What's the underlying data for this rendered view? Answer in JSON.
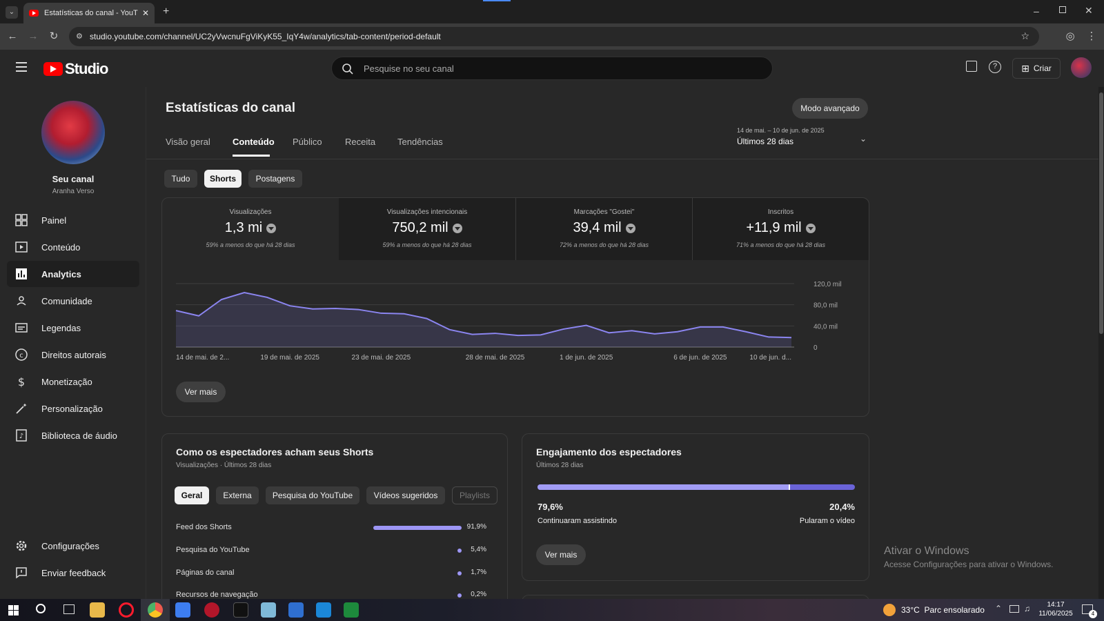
{
  "browser": {
    "tab_title": "Estatísticas do canal - YouTube",
    "url": "studio.youtube.com/channel/UC2yVwcnuFgViKyK55_IqY4w/analytics/tab-content/period-default"
  },
  "header": {
    "logo_text": "Studio",
    "search_placeholder": "Pesquise no seu canal",
    "create_label": "Criar"
  },
  "channel": {
    "name": "Seu canal",
    "handle": "Aranha Verso"
  },
  "sidebar": {
    "items": [
      {
        "label": "Painel",
        "icon": "dashboard-icon"
      },
      {
        "label": "Conteúdo",
        "icon": "content-icon"
      },
      {
        "label": "Analytics",
        "icon": "analytics-icon"
      },
      {
        "label": "Comunidade",
        "icon": "community-icon"
      },
      {
        "label": "Legendas",
        "icon": "subtitles-icon"
      },
      {
        "label": "Direitos autorais",
        "icon": "copyright-icon"
      },
      {
        "label": "Monetização",
        "icon": "monetization-icon"
      },
      {
        "label": "Personalização",
        "icon": "customization-icon"
      },
      {
        "label": "Biblioteca de áudio",
        "icon": "audio-library-icon"
      }
    ],
    "footer": [
      {
        "label": "Configurações",
        "icon": "settings-icon"
      },
      {
        "label": "Enviar feedback",
        "icon": "feedback-icon"
      }
    ]
  },
  "page": {
    "title": "Estatísticas do canal",
    "advanced_mode": "Modo avançado",
    "tabs": [
      "Visão geral",
      "Conteúdo",
      "Público",
      "Receita",
      "Tendências"
    ],
    "date_range": "14 de mai. – 10 de jun. de 2025",
    "date_label": "Últimos 28 dias",
    "filters": [
      "Tudo",
      "Shorts",
      "Postagens"
    ]
  },
  "metrics": [
    {
      "label": "Visualizações",
      "value": "1,3 mi",
      "sub": "59% a menos do que há 28 dias"
    },
    {
      "label": "Visualizações intencionais",
      "value": "750,2 mil",
      "sub": "59% a menos do que há 28 dias"
    },
    {
      "label": "Marcações \"Gostei\"",
      "value": "39,4 mil",
      "sub": "72% a menos do que há 28 dias"
    },
    {
      "label": "Inscritos",
      "value": "+11,9 mil",
      "sub": "71% a menos do que há 28 dias"
    }
  ],
  "chart_data": {
    "type": "area",
    "x": [
      "14 de mai.",
      "15 de mai.",
      "16 de mai.",
      "17 de mai.",
      "18 de mai.",
      "19 de mai.",
      "20 de mai.",
      "21 de mai.",
      "22 de mai.",
      "23 de mai.",
      "24 de mai.",
      "25 de mai.",
      "26 de mai.",
      "27 de mai.",
      "28 de mai.",
      "29 de mai.",
      "30 de mai.",
      "31 de mai.",
      "1 de jun.",
      "2 de jun.",
      "3 de jun.",
      "4 de jun.",
      "5 de jun.",
      "6 de jun.",
      "7 de jun.",
      "8 de jun.",
      "9 de jun.",
      "10 de jun."
    ],
    "series": [
      {
        "values": [
          69000,
          59000,
          90000,
          103000,
          94000,
          78000,
          72000,
          73000,
          71000,
          64000,
          63000,
          54000,
          33000,
          24000,
          26000,
          22000,
          23000,
          34000,
          41000,
          27000,
          31000,
          25000,
          29000,
          38000,
          38000,
          29000,
          19000,
          18000
        ]
      }
    ],
    "ylim": [
      0,
      120000
    ],
    "yticks": [
      "120,0 mil",
      "80,0 mil",
      "40,0 mil",
      "0"
    ],
    "xticks": [
      "14 de mai. de 2...",
      "19 de mai. de 2025",
      "23 de mai. de 2025",
      "28 de mai. de 2025",
      "1 de jun. de 2025",
      "6 de jun. de 2025",
      "10 de jun. d..."
    ],
    "color": "#8b85f0",
    "grid": true
  },
  "chart_more": "Ver mais",
  "sources": {
    "title": "Como os espectadores acham seus Shorts",
    "subtitle": "Visualizações · Últimos 28 dias",
    "chips": [
      "Geral",
      "Externa",
      "Pesquisa do YouTube",
      "Vídeos sugeridos",
      "Playlists"
    ],
    "rows": [
      {
        "label": "Feed dos Shorts",
        "value": "91,9%",
        "fraction": 0.919
      },
      {
        "label": "Pesquisa do YouTube",
        "value": "5,4%",
        "fraction": 0.054
      },
      {
        "label": "Páginas do canal",
        "value": "1,7%",
        "fraction": 0.017
      },
      {
        "label": "Recursos de navegação",
        "value": "0,2%",
        "fraction": 0.002
      }
    ]
  },
  "engagement": {
    "title": "Engajamento dos espectadores",
    "subtitle": "Últimos 28 dias",
    "continued_pct": "79,6%",
    "continued_label": "Continuaram assistindo",
    "continued_fraction": 0.796,
    "skipped_pct": "20,4%",
    "skipped_label": "Pularam o vídeo",
    "more": "Ver mais"
  },
  "windows": {
    "activate_title": "Ativar o Windows",
    "activate_sub": "Acesse Configurações para ativar o Windows.",
    "weather": "33°C  Parc ensolarado",
    "time": "14:17",
    "date": "11/06/2025",
    "notif_count": "4"
  },
  "colors": {
    "accent": "#8b85f0",
    "brand": "#ff0000"
  }
}
